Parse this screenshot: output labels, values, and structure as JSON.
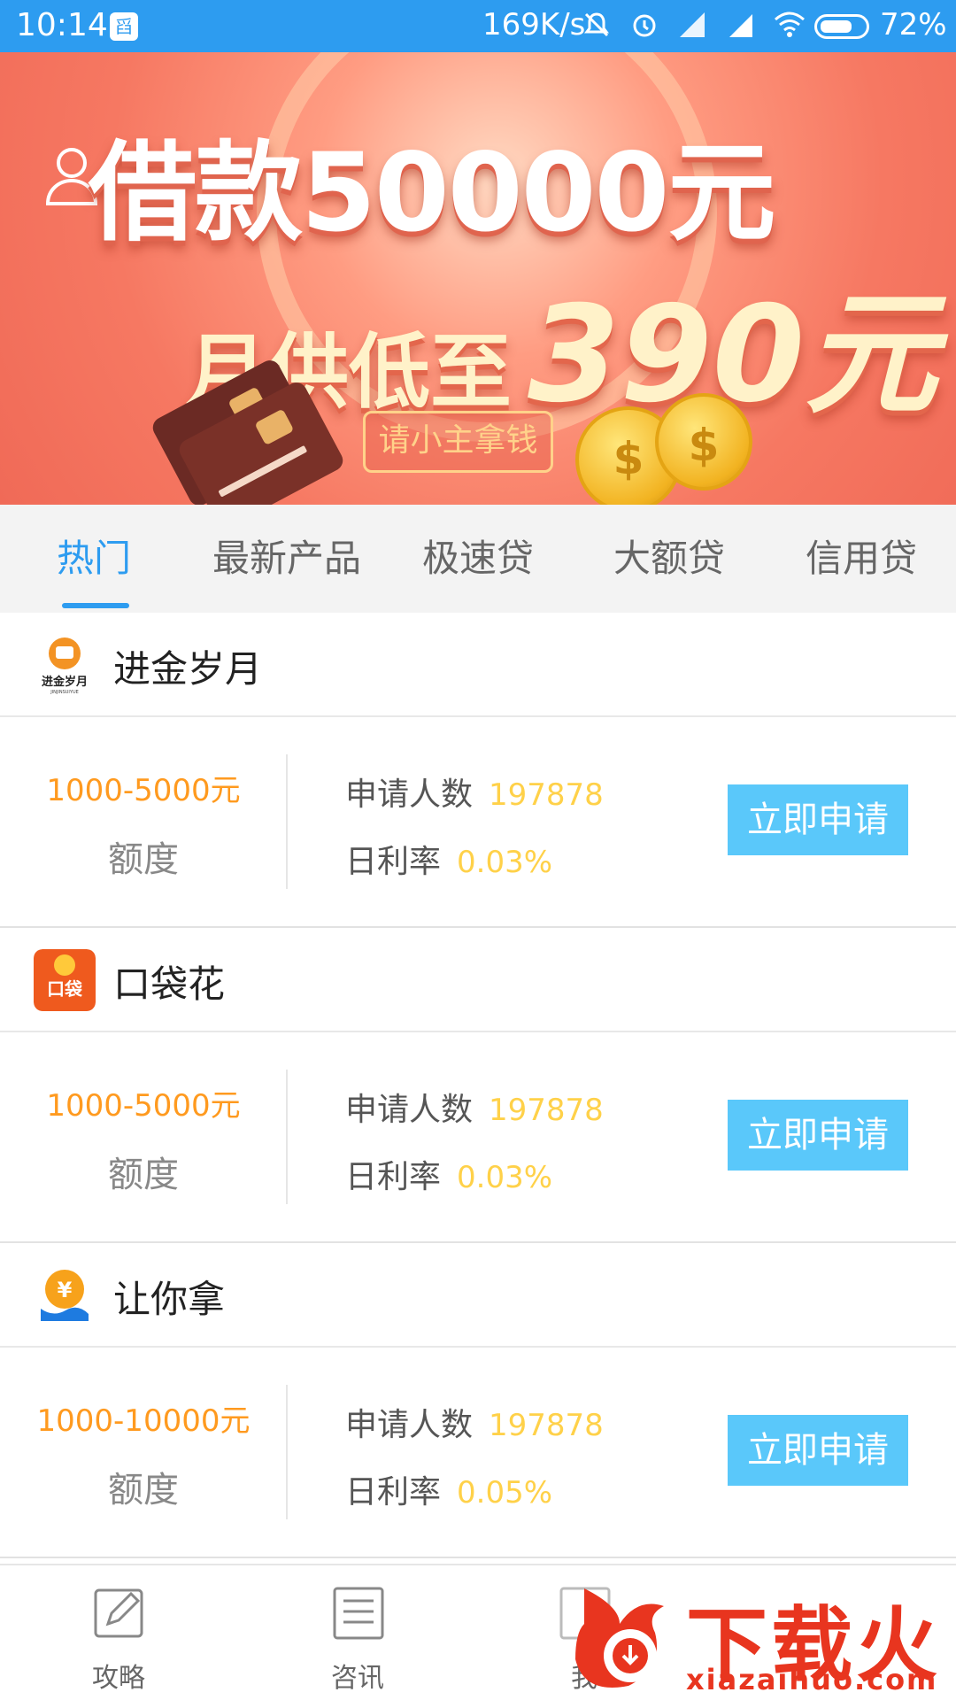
{
  "status_bar": {
    "time": "10:14",
    "app_badge": "舀",
    "network_speed": "169K/s",
    "battery_text": "72%",
    "battery_level": 0.72
  },
  "banner": {
    "headline": "借款50000元",
    "subline_prefix": "月供低至",
    "subline_amount": "390元",
    "cta": "请小主拿钱",
    "coin_symbol": "$",
    "page_count": 3,
    "active_page": 2
  },
  "tabs": [
    {
      "label": "热门",
      "active": true
    },
    {
      "label": "最新产品",
      "active": false
    },
    {
      "label": "极速贷",
      "active": false
    },
    {
      "label": "大额贷",
      "active": false
    },
    {
      "label": "信用贷",
      "active": false
    }
  ],
  "loans": [
    {
      "name": "进金岁月",
      "logo_text": "进金岁月",
      "logo_subtext": "JINJINSUIYUE",
      "amount": "1000-5000元",
      "amount_label": "额度",
      "applicants_label": "申请人数",
      "applicants_value": "197878",
      "rate_label": "日利率",
      "rate_value": "0.03%",
      "apply_label": "立即申请"
    },
    {
      "name": "口袋花",
      "logo_text": "口袋",
      "amount": "1000-5000元",
      "amount_label": "额度",
      "applicants_label": "申请人数",
      "applicants_value": "197878",
      "rate_label": "日利率",
      "rate_value": "0.03%",
      "apply_label": "立即申请"
    },
    {
      "name": "让你拿",
      "logo_text": "¥",
      "amount": "1000-10000元",
      "amount_label": "额度",
      "applicants_label": "申请人数",
      "applicants_value": "197878",
      "rate_label": "日利率",
      "rate_value": "0.05%",
      "apply_label": "立即申请"
    }
  ],
  "bottom_nav": [
    {
      "label": "攻略",
      "icon": "edit-icon"
    },
    {
      "label": "咨讯",
      "icon": "document-icon"
    },
    {
      "label": "我",
      "icon": "profile-icon"
    }
  ],
  "watermark": {
    "title": "下载火",
    "url": "xiazaihuo.com"
  },
  "colors": {
    "status_bar": "#2d9cf0",
    "tab_active": "#2d9cf0",
    "amount": "#ff9a1f",
    "stat_value": "#ffd149",
    "apply_button": "#5ac8fa",
    "watermark": "#e8351f"
  }
}
